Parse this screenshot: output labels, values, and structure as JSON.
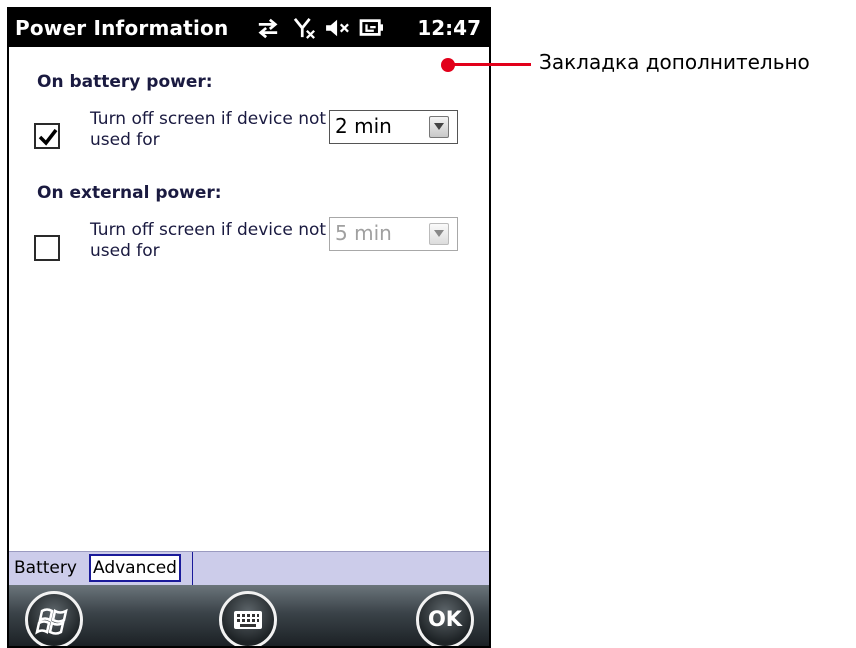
{
  "titlebar": {
    "title": "Power Information",
    "time": "12:47",
    "icons": [
      "connectivity-icon",
      "no-signal-icon",
      "speaker-muted-icon",
      "battery-charging-icon"
    ]
  },
  "battery_section": {
    "heading": "On battery power:",
    "checkbox_checked": true,
    "label": "Turn off screen if device not used for",
    "dropdown_value": "2 min",
    "dropdown_enabled": true
  },
  "external_section": {
    "heading": "On external power:",
    "checkbox_checked": false,
    "label": "Turn off screen if device not used for",
    "dropdown_value": "5 min",
    "dropdown_enabled": false
  },
  "tabs": [
    {
      "label": "Battery",
      "selected": false
    },
    {
      "label": "Advanced",
      "selected": true
    }
  ],
  "softkeys": {
    "start": "windows-start-icon",
    "keyboard": "keyboard-icon",
    "ok_label": "OK"
  },
  "annotation": {
    "text": "Закладка дополнительно",
    "color": "#e2001a"
  }
}
